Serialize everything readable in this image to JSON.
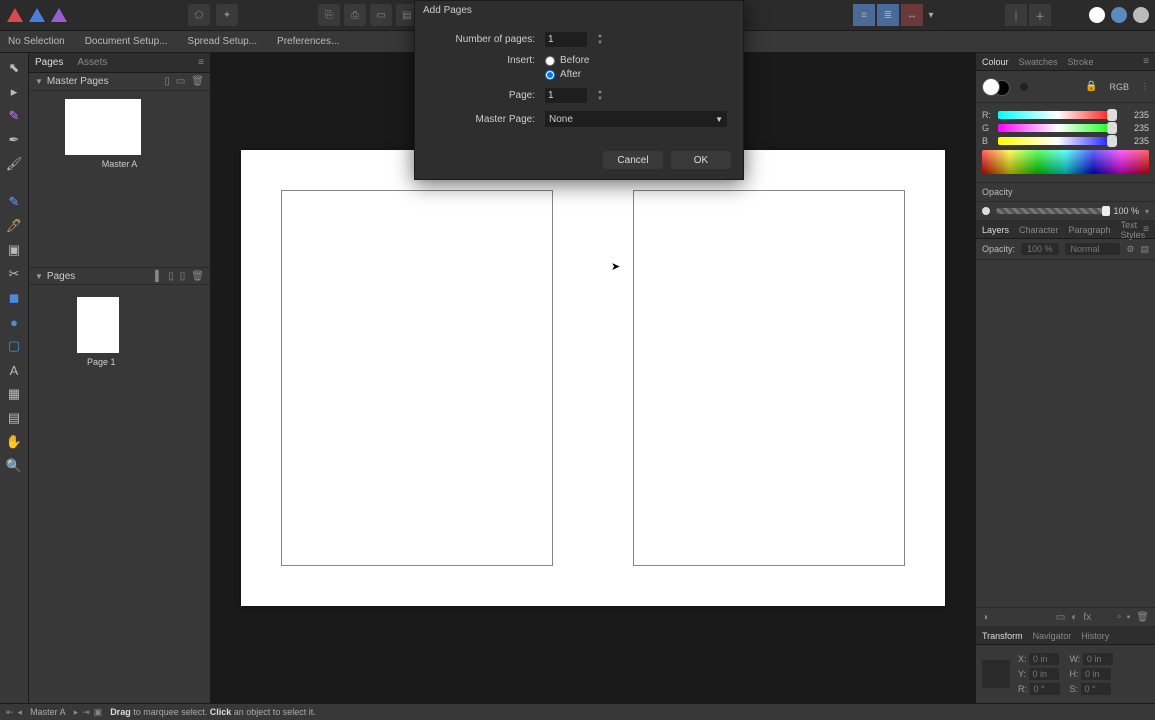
{
  "toolbar": {
    "arrow_down": "▾"
  },
  "options_bar": {
    "selection": "No Selection",
    "doc_setup": "Document Setup...",
    "spread_setup": "Spread Setup...",
    "preferences": "Preferences..."
  },
  "pages_panel": {
    "tabs": {
      "pages": "Pages",
      "assets": "Assets"
    },
    "master_section": "Master Pages",
    "master_name": "Master A",
    "pages_section": "Pages",
    "page1": "Page 1"
  },
  "dialog": {
    "title": "Add Pages",
    "num_pages_label": "Number of pages:",
    "num_pages_value": "1",
    "insert_label": "Insert:",
    "before": "Before",
    "after": "After",
    "page_label": "Page:",
    "page_value": "1",
    "master_label": "Master Page:",
    "master_value": "None",
    "cancel": "Cancel",
    "ok": "OK"
  },
  "right": {
    "color_tabs": {
      "colour": "Colour",
      "swatches": "Swatches",
      "stroke": "Stroke"
    },
    "rgb": "RGB",
    "r": "R:",
    "g": "G",
    "b": "B",
    "val235": "235",
    "opacity_label": "Opacity",
    "opacity_val": "100 %",
    "layer_tabs": {
      "layers": "Layers",
      "character": "Character",
      "paragraph": "Paragraph",
      "textstyles": "Text Styles"
    },
    "layers_opacity_label": "Opacity:",
    "layers_opacity_val": "100 %",
    "layers_blend": "Normal",
    "transform_tabs": {
      "transform": "Transform",
      "navigator": "Navigator",
      "history": "History"
    },
    "x": "X:",
    "y": "Y:",
    "w": "W:",
    "h": "H:",
    "s": "S:",
    "zero_in": "0 in",
    "zero_deg": "0 °"
  },
  "status": {
    "master": "Master A",
    "hint_pre": "Drag",
    "hint_mid1": " to marquee select. ",
    "hint_click": "Click",
    "hint_mid2": " an object to select it."
  }
}
